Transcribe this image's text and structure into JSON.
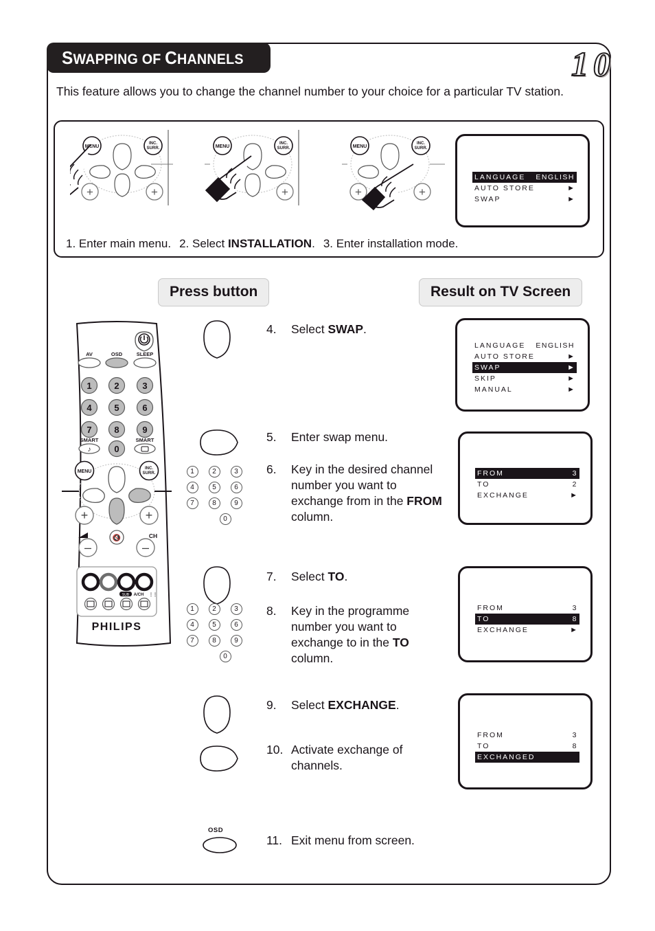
{
  "header": {
    "title_first_letter": "S",
    "title_part1": "WAPPING OF ",
    "title_c": "C",
    "title_part2": "HANNELS",
    "title_full": "Swapping of Channels",
    "page_number": "10"
  },
  "intro": {
    "text": "This feature allows you to change the channel number to your choice for a particular TV station."
  },
  "top_panel": {
    "caption_1": "1. Enter main menu.",
    "caption_2_pre": "2. Select ",
    "caption_2_bold": "INSTALLATION",
    "caption_2_post": ".",
    "caption_3": "3. Enter installation mode.",
    "pads": [
      {
        "menu_label": "MENU",
        "surr_label": "INC. SURR.",
        "pressed": "menu"
      },
      {
        "menu_label": "MENU",
        "surr_label": "INC. SURR.",
        "pressed": "up"
      },
      {
        "menu_label": "MENU",
        "surr_label": "INC. SURR.",
        "pressed": "right"
      }
    ]
  },
  "columns": {
    "press_button": "Press button",
    "result_on_tv": "Result on TV Screen"
  },
  "remote": {
    "brand": "PHILIPS",
    "top_buttons": [
      "AV",
      "OSD",
      "SLEEP"
    ],
    "power_icon": "power-icon",
    "numbers": [
      "1",
      "2",
      "3",
      "4",
      "5",
      "6",
      "7",
      "8",
      "9",
      "0"
    ],
    "smart_left_label": "SMART",
    "smart_right_label": "SMART",
    "menu_label": "MENU",
    "inc_surr_label": "INC. SURR.",
    "volume_label": "◢",
    "channel_label": "CH",
    "mute_icon": "mute-icon",
    "teletext_labels": [
      "SUB",
      "A/CH",
      "⋮⋮"
    ]
  },
  "steps": [
    {
      "num": "4.",
      "text_parts": [
        {
          "t": "Select ",
          "b": false
        },
        {
          "t": "SWAP",
          "b": true
        },
        {
          "t": ".",
          "b": false
        }
      ],
      "plain": "Select SWAP.",
      "glyph": "down-cursor-button"
    },
    {
      "num": "5.",
      "plain": "Enter swap menu.",
      "glyph": "right-cursor-button"
    },
    {
      "num": "6.",
      "text_parts": [
        {
          "t": "Key in the desired channel number you want to exchange from in the ",
          "b": false
        },
        {
          "t": "FROM",
          "b": true
        },
        {
          "t": " column.",
          "b": false
        }
      ],
      "plain": "Key in the desired channel number you want to exchange from in the FROM column.",
      "glyph": "numeric-keypad"
    },
    {
      "num": "7.",
      "text_parts": [
        {
          "t": "Select ",
          "b": false
        },
        {
          "t": "TO",
          "b": true
        },
        {
          "t": ".",
          "b": false
        }
      ],
      "plain": "Select TO.",
      "glyph": "down-cursor-button"
    },
    {
      "num": "8.",
      "text_parts": [
        {
          "t": "Key in the programme number you want to exchange to in the ",
          "b": false
        },
        {
          "t": "TO",
          "b": true
        },
        {
          "t": " column.",
          "b": false
        }
      ],
      "plain": "Key in the programme number you want to exchange to in the TO column.",
      "glyph": "numeric-keypad"
    },
    {
      "num": "9.",
      "text_parts": [
        {
          "t": "Select ",
          "b": false
        },
        {
          "t": "EXCHANGE",
          "b": true
        },
        {
          "t": ".",
          "b": false
        }
      ],
      "plain": "Select EXCHANGE.",
      "glyph": "down-cursor-button"
    },
    {
      "num": "10.",
      "plain": "Activate exchange of channels.",
      "glyph": "right-cursor-button"
    },
    {
      "num": "11.",
      "plain": "Exit menu from screen.",
      "glyph": "osd-button",
      "glyph_label": "OSD"
    }
  ],
  "tv_screens": [
    {
      "id": "tv-1",
      "lines": [
        {
          "label": "LANGUAGE",
          "value": "ENGLISH",
          "highlight": true,
          "arrow": false
        },
        {
          "label": "AUTO STORE",
          "value": "",
          "highlight": false,
          "arrow": true
        },
        {
          "label": "SWAP",
          "value": "",
          "highlight": false,
          "arrow": true
        }
      ]
    },
    {
      "id": "tv-2",
      "lines": [
        {
          "label": "LANGUAGE",
          "value": "ENGLISH",
          "highlight": false,
          "arrow": false
        },
        {
          "label": "AUTO STORE",
          "value": "",
          "highlight": false,
          "arrow": true
        },
        {
          "label": "SWAP",
          "value": "",
          "highlight": true,
          "arrow": true
        },
        {
          "label": "SKIP",
          "value": "",
          "highlight": false,
          "arrow": true
        },
        {
          "label": "MANUAL",
          "value": "",
          "highlight": false,
          "arrow": true
        }
      ]
    },
    {
      "id": "tv-3",
      "lines": [
        {
          "label": "FROM",
          "value": "3",
          "highlight": true,
          "arrow": false
        },
        {
          "label": "TO",
          "value": "2",
          "highlight": false,
          "arrow": false
        },
        {
          "label": "EXCHANGE",
          "value": "",
          "highlight": false,
          "arrow": true
        }
      ]
    },
    {
      "id": "tv-4",
      "lines": [
        {
          "label": "FROM",
          "value": "3",
          "highlight": false,
          "arrow": false
        },
        {
          "label": "TO",
          "value": "8",
          "highlight": true,
          "arrow": false
        },
        {
          "label": "EXCHANGE",
          "value": "",
          "highlight": false,
          "arrow": true
        }
      ]
    },
    {
      "id": "tv-5",
      "lines": [
        {
          "label": "FROM",
          "value": "3",
          "highlight": false,
          "arrow": false
        },
        {
          "label": "TO",
          "value": "8",
          "highlight": false,
          "arrow": false
        },
        {
          "label": "EXCHANGED",
          "value": "",
          "highlight": true,
          "arrow": false
        }
      ]
    }
  ],
  "colors": {
    "ink": "#1a1419",
    "pill_bg": "#ededed",
    "key_grey": "#bcbcbc",
    "page_bg": "#ffffff"
  }
}
